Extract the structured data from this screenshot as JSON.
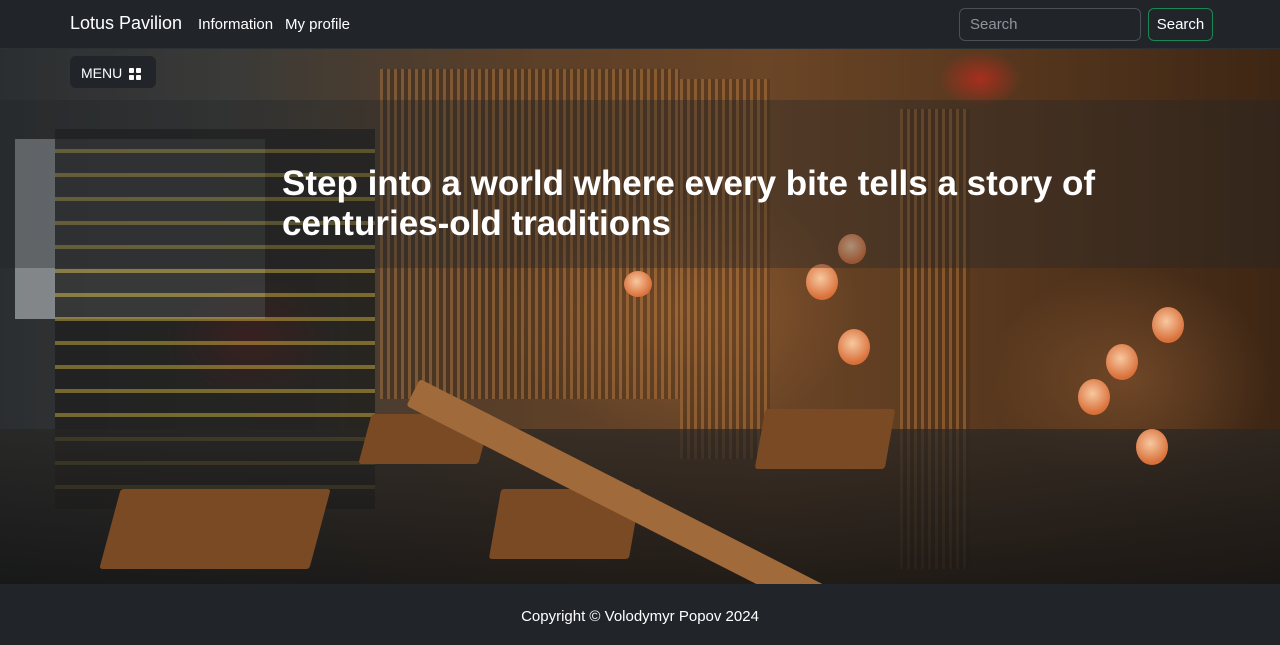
{
  "navbar": {
    "brand": "Lotus Pavilion",
    "links": [
      {
        "label": "Information"
      },
      {
        "label": "My profile"
      }
    ],
    "search": {
      "placeholder": "Search",
      "button_label": "Search"
    }
  },
  "hero": {
    "menu_label": "MENU",
    "menu_icon": "grid-icon",
    "headline": "Step into a world where every bite tells a story of centuries-old traditions"
  },
  "footer": {
    "copyright": "Copyright © Volodymyr Popov 2024"
  },
  "colors": {
    "background": "#212529",
    "search_button_border": "#198754",
    "text": "#ffffff"
  }
}
